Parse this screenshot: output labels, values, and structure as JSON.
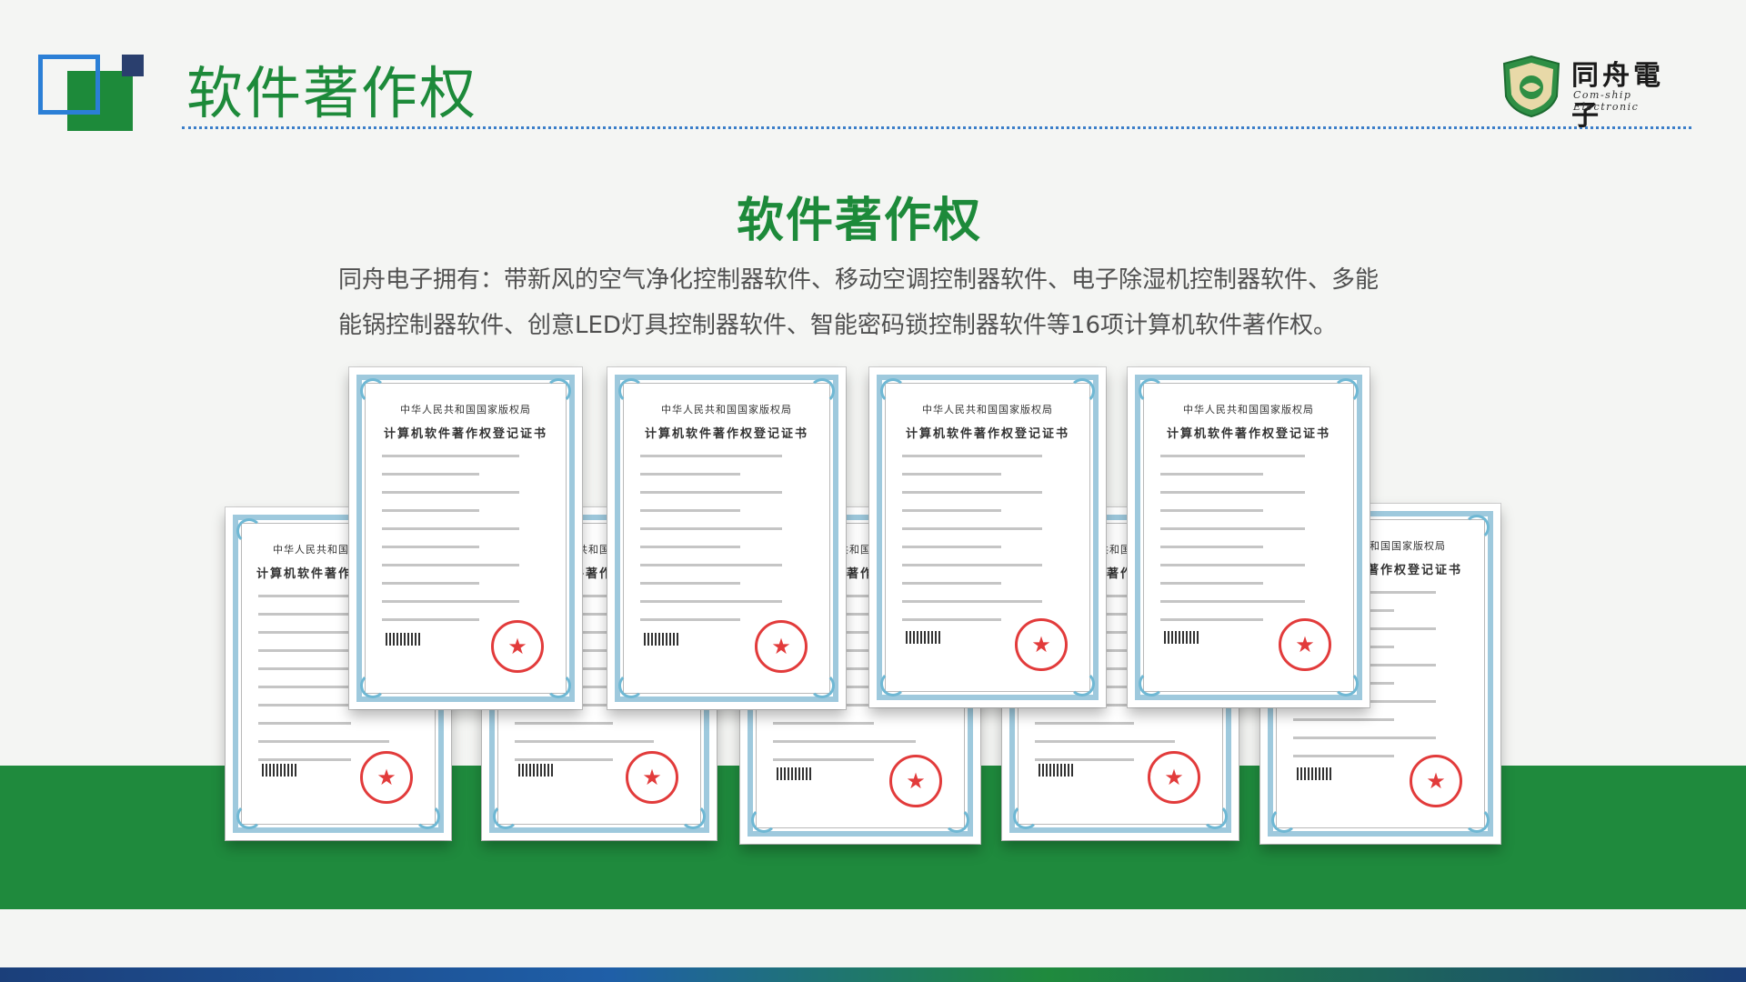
{
  "header": {
    "title": "软件著作权"
  },
  "brand": {
    "name_cn": "同舟電子",
    "name_en": "Com-ship Electronic"
  },
  "content": {
    "heading": "软件著作权",
    "description": "同舟电子拥有：带新风的空气净化控制器软件、移动空调控制器软件、电子除湿机控制器软件、多能能锅控制器软件、创意LED灯具控制器软件、智能密码锁控制器软件等16项计算机软件著作权。"
  },
  "certificate": {
    "issuer": "中华人民共和国国家版权局",
    "title": "计算机软件著作权登记证书",
    "seal_glyph": "★"
  },
  "colors": {
    "accent_green": "#1d8a3a",
    "band_green": "#1f8a3d",
    "accent_blue": "#2b7fd6",
    "navy": "#2a3f6e",
    "seal_red": "#e23b3b"
  }
}
